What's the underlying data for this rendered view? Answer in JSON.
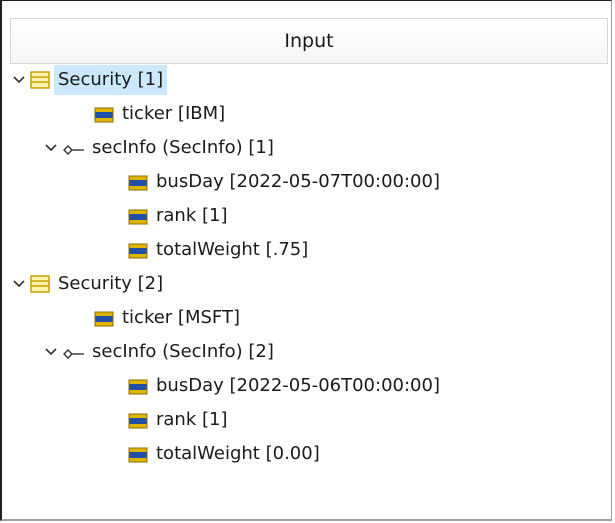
{
  "panel": {
    "header_title": "Input"
  },
  "tree": [
    {
      "depth": 0,
      "type": "element",
      "expanded": true,
      "label": "Security [1]",
      "icon": "element-icon",
      "selected": true
    },
    {
      "depth": 1,
      "type": "field",
      "label": "ticker [IBM]",
      "icon": "field-icon"
    },
    {
      "depth": 1,
      "type": "group",
      "expanded": true,
      "label": "secInfo (SecInfo) [1]",
      "icon": "relation-icon"
    },
    {
      "depth": 2,
      "type": "field",
      "label": "busDay [2022-05-07T00:00:00]",
      "icon": "field-icon"
    },
    {
      "depth": 2,
      "type": "field",
      "label": "rank [1]",
      "icon": "field-icon"
    },
    {
      "depth": 2,
      "type": "field",
      "label": "totalWeight [.75]",
      "icon": "field-icon"
    },
    {
      "depth": 0,
      "type": "element",
      "expanded": true,
      "label": "Security [2]",
      "icon": "element-icon"
    },
    {
      "depth": 1,
      "type": "field",
      "label": "ticker [MSFT]",
      "icon": "field-icon"
    },
    {
      "depth": 1,
      "type": "group",
      "expanded": true,
      "label": "secInfo (SecInfo) [2]",
      "icon": "relation-icon"
    },
    {
      "depth": 2,
      "type": "field",
      "label": "busDay [2022-05-06T00:00:00]",
      "icon": "field-icon"
    },
    {
      "depth": 2,
      "type": "field",
      "label": "rank [1]",
      "icon": "field-icon"
    },
    {
      "depth": 2,
      "type": "field",
      "label": "totalWeight [0.00]",
      "icon": "field-icon"
    }
  ],
  "colors": {
    "selection": "#cce8ff",
    "element_icon_fill": "#fff3b0",
    "element_icon_stroke": "#c8a000",
    "field_icon_fill": "#1f4fa8",
    "field_icon_stroke": "#e0b400"
  }
}
